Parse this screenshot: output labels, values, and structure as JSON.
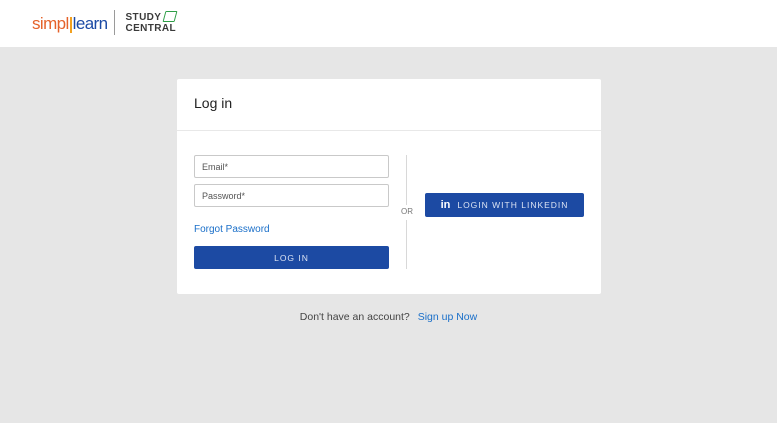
{
  "header": {
    "logo": {
      "simpli": "simpl",
      "learn": "learn",
      "product_line1": "STUDY",
      "product_line2": "CENTRAL"
    }
  },
  "login": {
    "title": "Log in",
    "email_placeholder": "Email*",
    "password_placeholder": "Password*",
    "forgot_password": "Forgot Password",
    "login_button": "LOG IN",
    "or_label": "OR",
    "linkedin_icon": "in",
    "linkedin_button": "LOGIN WITH LINKEDIN"
  },
  "signup": {
    "question": "Don't have an account?",
    "link": "Sign up Now"
  },
  "colors": {
    "page_bg": "#e6e6e6",
    "primary_button": "#1c4aa3",
    "link": "#1a6fc9",
    "brand_orange": "#e5622a",
    "brand_blue": "#1b4aa5",
    "brand_green": "#2e9e47"
  }
}
